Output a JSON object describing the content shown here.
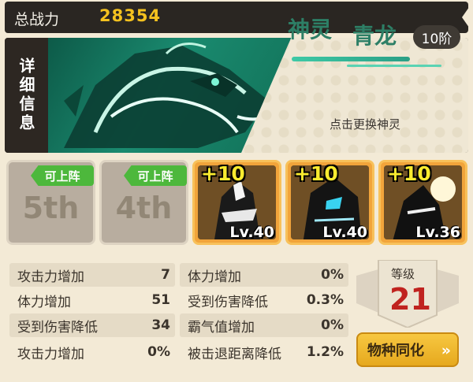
{
  "top": {
    "label": "总战力",
    "value": "28354"
  },
  "banner": {
    "detail_tab": "详细信息",
    "god_type": "神灵",
    "god_name": "青龙",
    "rank": "10阶",
    "change_label": "点击更换神灵"
  },
  "slots": {
    "locked": [
      {
        "label": "5th",
        "tag": "可上阵"
      },
      {
        "label": "4th",
        "tag": "可上阵"
      }
    ],
    "heroes": [
      {
        "plus": "+10",
        "level": "Lv.40"
      },
      {
        "plus": "+10",
        "level": "Lv.40"
      },
      {
        "plus": "+10",
        "level": "Lv.36"
      }
    ]
  },
  "stats": {
    "left": [
      {
        "name": "攻击力增加",
        "value": "7"
      },
      {
        "name": "体力增加",
        "value": "51"
      },
      {
        "name": "受到伤害降低",
        "value": "34"
      },
      {
        "name": "攻击力增加",
        "value": "0%"
      }
    ],
    "right": [
      {
        "name": "体力增加",
        "value": "0%"
      },
      {
        "name": "受到伤害降低",
        "value": "0.3%"
      },
      {
        "name": "霸气值增加",
        "value": "0%"
      },
      {
        "name": "被击退距离降低",
        "value": "1.2%"
      }
    ]
  },
  "level": {
    "label": "等级",
    "value": "21"
  },
  "sync_button": {
    "label": "物种同化",
    "arrow": "»"
  },
  "colors": {
    "accent_gold": "#f4c21f",
    "teal": "#2d7f66",
    "level_red": "#c0231f",
    "green_tag": "#4db83c"
  },
  "icons": {
    "sync_arrow": "double-chevron-right-icon"
  }
}
